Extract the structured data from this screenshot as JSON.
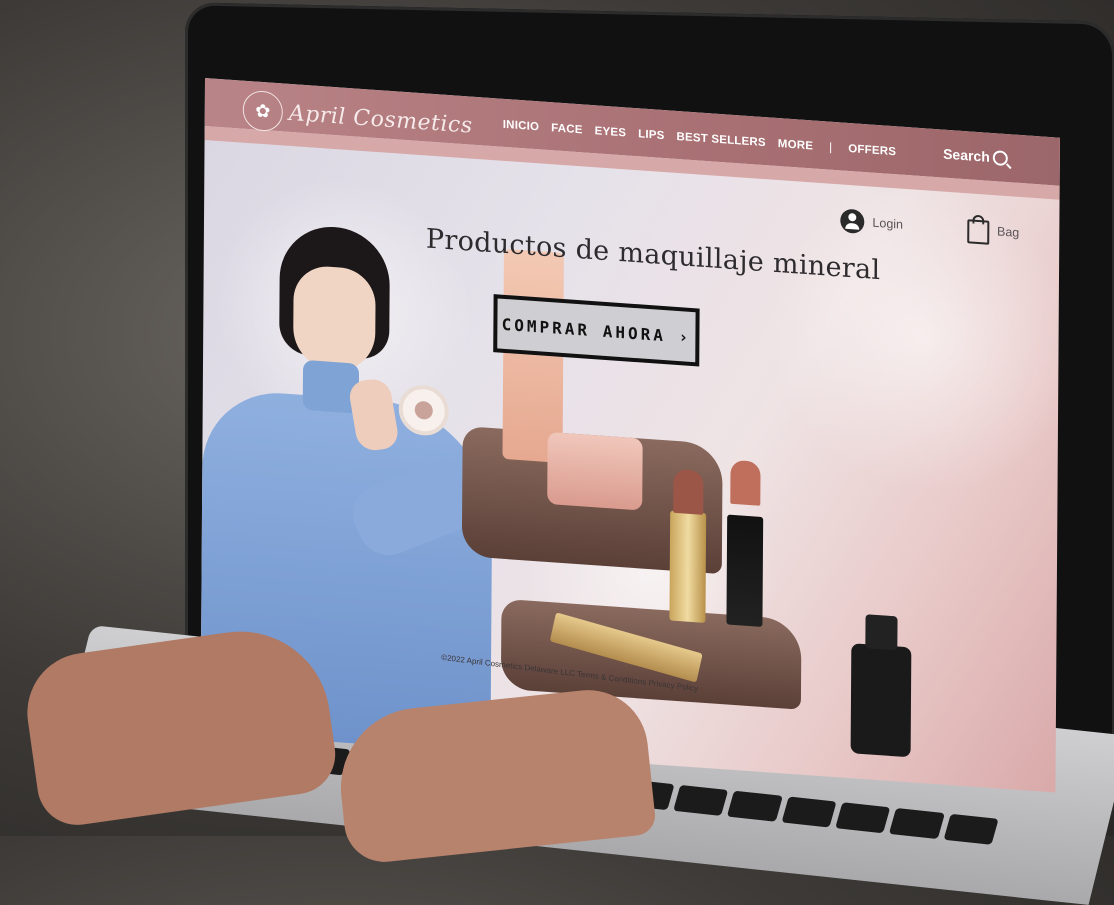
{
  "header": {
    "logo_text": "April Cosmetics",
    "nav": [
      "INICIO",
      "FACE",
      "EYES",
      "LIPS",
      "BEST SELLERS",
      "MORE"
    ],
    "separator": "|",
    "offers": "OFFERS",
    "search_label": "Search"
  },
  "user": {
    "login_label": "Login",
    "bag_label": "Bag"
  },
  "hero": {
    "title": "Productos de maquillaje mineral",
    "cta_label": "COMPRAR AHORA ›"
  },
  "footer": {
    "text": "©2022 April Cosmetics Delaware LLC Terms & Conditions Privacy Policy"
  },
  "colors": {
    "header_bg": "#a87073",
    "header_stripe": "#d7a8a8",
    "cta_bg": "#cfcfd3",
    "cta_border": "#111111"
  },
  "icons": [
    "logo-emblem-icon",
    "search-icon",
    "user-icon",
    "bag-icon",
    "chevron-right-icon"
  ]
}
